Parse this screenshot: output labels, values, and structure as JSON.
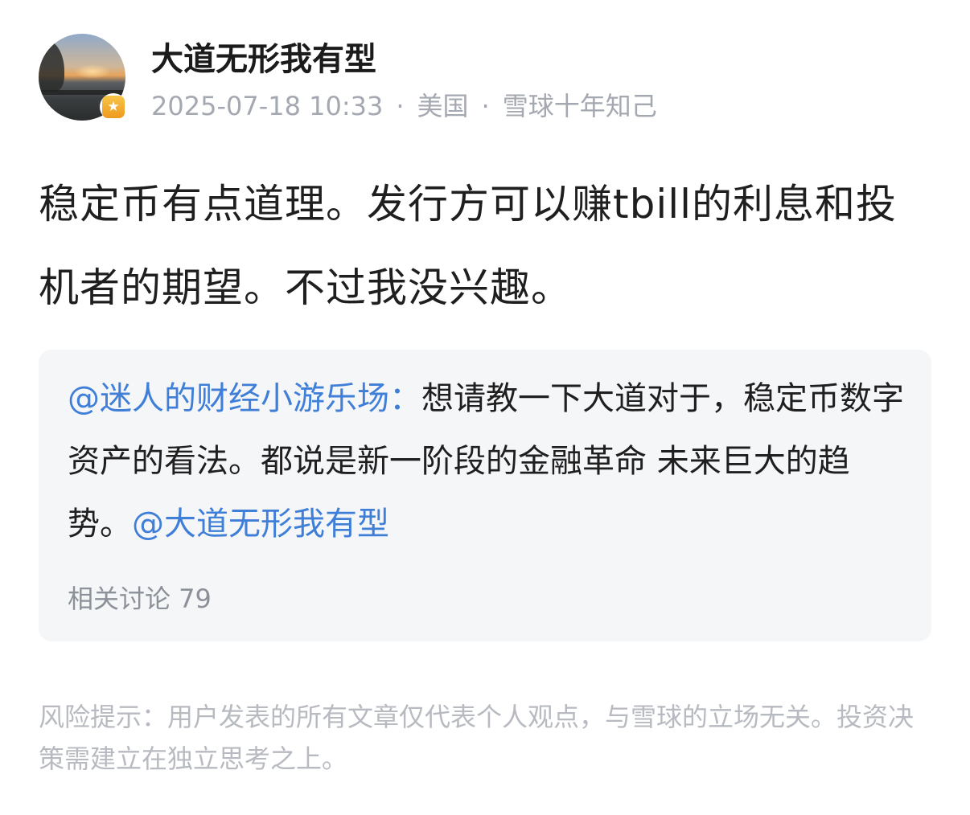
{
  "author": {
    "name": "大道无形我有型",
    "avatar_icon": "user-avatar-photo",
    "badge_icon": "star-badge-icon",
    "badge_glyph": "★"
  },
  "meta": {
    "timestamp": "2025-07-18 10:33",
    "separator": "·",
    "location": "美国",
    "tag": "雪球十年知己"
  },
  "post": {
    "content": "稳定币有点道理。发行方可以赚tbill的利息和投机者的期望。不过我没兴趣。"
  },
  "quote": {
    "mention": "@迷人的财经小游乐场：",
    "text": "想请教一下大道对于，稳定币数字资产的看法。都说是新一阶段的金融革命 未来巨大的趋势。",
    "trailing_mention": "@大道无形我有型",
    "related_label": "相关讨论 79"
  },
  "risk_notice": "风险提示：用户发表的所有文章仅代表个人观点，与雪球的立场无关。投资决策需建立在独立思考之上。",
  "colors": {
    "mention": "#3f7fd7",
    "meta_text": "#a4a8b0",
    "card_bg": "#f5f6f8",
    "badge": "#f0a21f"
  }
}
